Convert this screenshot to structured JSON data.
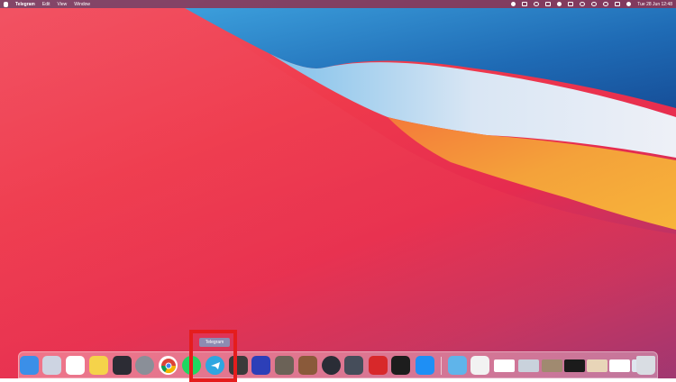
{
  "menubar": {
    "app_name": "Telegram",
    "menus": [
      "Edit",
      "View",
      "Window"
    ],
    "clock": "Tue 28 Jun  12:48"
  },
  "dock": {
    "tooltip": "Telegram",
    "apps": [
      {
        "name": "finder-icon",
        "color": "#3b8fe8"
      },
      {
        "name": "launchpad-icon",
        "color": "#cdd4e2"
      },
      {
        "name": "photos-icon",
        "color": "#ffffff"
      },
      {
        "name": "notes-icon",
        "color": "#f5d34a"
      },
      {
        "name": "final-cut-icon",
        "color": "#2c2c34"
      },
      {
        "name": "system-preferences-icon",
        "color": "#8a8f98"
      },
      {
        "name": "chrome-icon",
        "color": "#ffffff"
      },
      {
        "name": "spotify-icon",
        "color": "#1ed760"
      },
      {
        "name": "telegram-icon",
        "color": "#2ea6e0"
      },
      {
        "name": "app-icon-dark",
        "color": "#3a3a3a"
      },
      {
        "name": "headphones-icon",
        "color": "#2c3fb8"
      },
      {
        "name": "gimp-icon",
        "color": "#6b6257"
      },
      {
        "name": "app-icon-animal",
        "color": "#8a5a3a"
      },
      {
        "name": "obs-icon",
        "color": "#2a2d36"
      },
      {
        "name": "photo-app-icon",
        "color": "#454d5a"
      },
      {
        "name": "acrobat-icon",
        "color": "#d8282a"
      },
      {
        "name": "terminal-icon",
        "color": "#1d1d1d"
      },
      {
        "name": "app-store-icon",
        "color": "#1e8ff5"
      },
      {
        "name": "folder-icon",
        "color": "#5fb4ea"
      },
      {
        "name": "document-icon",
        "color": "#f2f2f2"
      },
      {
        "name": "window-thumbnail-icon",
        "color": "#ffffff"
      },
      {
        "name": "window-thumbnail-icon",
        "color": "#c9d2dc"
      },
      {
        "name": "window-thumbnail-icon",
        "color": "#a08a70"
      },
      {
        "name": "window-thumbnail-icon",
        "color": "#1b1b1b"
      },
      {
        "name": "window-thumbnail-icon",
        "color": "#e8d5b8"
      },
      {
        "name": "window-thumbnail-icon",
        "color": "#ffffff"
      },
      {
        "name": "window-thumbnail-icon",
        "color": "#dfe6ef"
      },
      {
        "name": "trash-icon",
        "color": "#d9dde3"
      }
    ]
  },
  "highlight_color": "#e51d1d"
}
